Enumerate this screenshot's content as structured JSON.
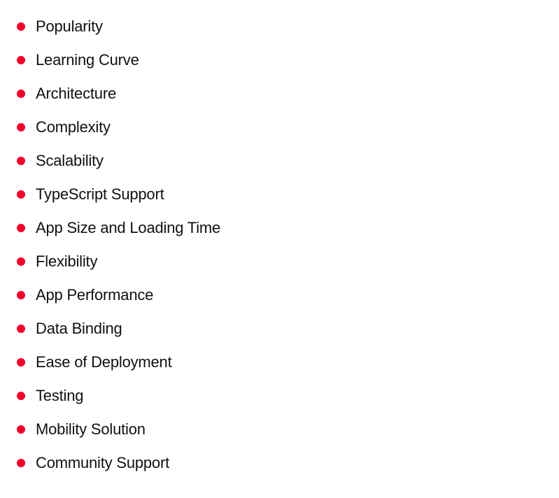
{
  "colors": {
    "bullet": "#F5002C",
    "text": "#111111",
    "background": "#FFFFFF"
  },
  "list": {
    "items": [
      {
        "label": "Popularity"
      },
      {
        "label": "Learning Curve"
      },
      {
        "label": "Architecture"
      },
      {
        "label": "Complexity"
      },
      {
        "label": "Scalability"
      },
      {
        "label": "TypeScript Support"
      },
      {
        "label": "App Size and Loading Time"
      },
      {
        "label": "Flexibility"
      },
      {
        "label": "App Performance"
      },
      {
        "label": "Data Binding"
      },
      {
        "label": "Ease of Deployment"
      },
      {
        "label": "Testing"
      },
      {
        "label": "Mobility Solution"
      },
      {
        "label": "Community Support"
      }
    ]
  }
}
